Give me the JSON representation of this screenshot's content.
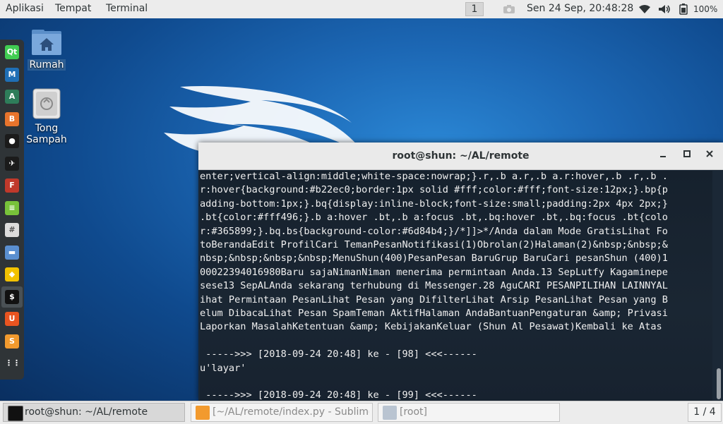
{
  "topbar": {
    "menu": [
      "Aplikasi",
      "Tempat",
      "Terminal"
    ],
    "workspace_indicator": "1",
    "datetime": "Sen 24 Sep, 20:48:28",
    "battery": "100%",
    "icons": [
      "camera-icon",
      "wifi-icon",
      "volume-icon",
      "battery-icon"
    ]
  },
  "dock": {
    "apps": [
      {
        "name": "qt-creator",
        "label": "Qt",
        "color": "#41cd52"
      },
      {
        "name": "metasploit",
        "label": "M",
        "color": "#1f6fb5"
      },
      {
        "name": "armitage",
        "label": "A",
        "color": "#2e7d5a"
      },
      {
        "name": "burpsuite",
        "label": "B",
        "color": "#e8742c"
      },
      {
        "name": "beef",
        "label": "●",
        "color": "#1b1b1b"
      },
      {
        "name": "maltego",
        "label": "✈",
        "color": "#1b1b1b"
      },
      {
        "name": "faraday",
        "label": "F",
        "color": "#c0392b"
      },
      {
        "name": "leafpad",
        "label": "≡",
        "color": "#78c23a"
      },
      {
        "name": "calculator",
        "label": "#",
        "color": "#dcdcdc"
      },
      {
        "name": "files",
        "label": "▬",
        "color": "#5a8fd0"
      },
      {
        "name": "cherrytree",
        "label": "◆",
        "color": "#f2c200"
      },
      {
        "name": "terminal",
        "label": "$",
        "color": "#111"
      },
      {
        "name": "ubuntu-software",
        "label": "U",
        "color": "#e95420"
      },
      {
        "name": "sublime-text",
        "label": "S",
        "color": "#f29a2e"
      },
      {
        "name": "show-apps",
        "label": "⋮⋮",
        "color": "#2f3437"
      }
    ]
  },
  "desktop": {
    "icons": [
      {
        "label": "Rumah"
      },
      {
        "label_line1": "Tong",
        "label_line2": "Sampah"
      }
    ]
  },
  "terminal": {
    "title": "root@shun: ~/AL/remote",
    "lines": [
      "enter;vertical-align:middle;white-space:nowrap;}.r,.b a.r,.b a.r:hover,.b .r,.b .",
      "r:hover{background:#b22ec0;border:1px solid #fff;color:#fff;font-size:12px;}.bp{p",
      "adding-bottom:1px;}.bq{display:inline-block;font-size:small;padding:2px 4px 2px;}",
      ".bt{color:#fff496;}.b a:hover .bt,.b a:focus .bt,.bq:hover .bt,.bq:focus .bt{colo",
      "r:#365899;}.bq.bs{background-color:#6d84b4;}/*]]>*/Anda dalam Mode GratisLihat Fo",
      "toBerandaEdit ProfilCari TemanPesanNotifikasi(1)Obrolan(2)Halaman(2)&nbsp;&nbsp;&",
      "nbsp;&nbsp;&nbsp;&nbsp;MenuShun(400)PesanPesan BaruGrup BaruCari pesanShun (400)1",
      "00022394016980Baru sajaNimanNiman menerima permintaan Anda.13 SepLutfy Kagaminepe",
      "sese13 SepALAnda sekarang terhubung di Messenger.28 AguCARI PESANPILIHAN LAINNYAL",
      "ihat Permintaan PesanLihat Pesan yang DifilterLihat Arsip PesanLihat Pesan yang B",
      "elum DibacaLihat Pesan SpamTeman AktifHalaman AndaBantuanPengaturan &amp; Privasi",
      "Laporkan MasalahKetentuan &amp; KebijakanKeluar (Shun Al Pesawat)Kembali ke Atas",
      "",
      " ----->>> [2018-09-24 20:48] ke - [98] <<<------",
      "u'layar'",
      "",
      " ----->>> [2018-09-24 20:48] ke - [99] <<<------"
    ]
  },
  "taskbar": {
    "tasks": [
      {
        "label": "root@shun: ~/AL/remote",
        "icon": "terminal-icon",
        "active": true
      },
      {
        "label": "[~/AL/remote/index.py - Sublime Te...",
        "icon": "sublime-icon",
        "active": false
      },
      {
        "label": "[root]",
        "icon": "folder-icon",
        "active": false
      }
    ],
    "workspace_pager": "1 / 4"
  },
  "colors": {
    "topbar_bg": "#ececec",
    "terminal_bg": "#1b2836",
    "desktop_blue": "#1c67b4"
  }
}
